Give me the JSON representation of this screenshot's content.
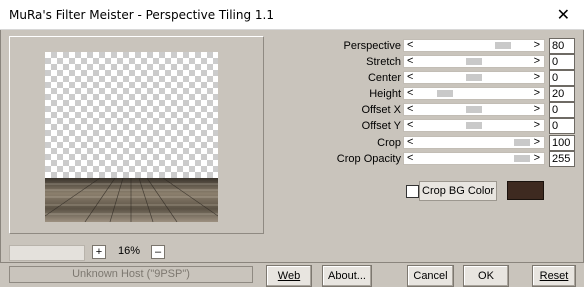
{
  "window": {
    "title": "MuRa's Filter Meister - Perspective Tiling 1.1",
    "close_glyph": "✕"
  },
  "sliders": [
    {
      "label": "Perspective",
      "value": "80",
      "level": 0.8
    },
    {
      "label": "Stretch",
      "value": "0",
      "level": 0.5
    },
    {
      "label": "Center",
      "value": "0",
      "level": 0.5
    },
    {
      "label": "Height",
      "value": "20",
      "level": 0.2
    },
    {
      "label": "Offset X",
      "value": "0",
      "level": 0.5
    },
    {
      "label": "Offset Y",
      "value": "0",
      "level": 0.5
    },
    {
      "label": "Crop",
      "value": "100",
      "level": 1.0
    },
    {
      "label": "Crop Opacity",
      "value": "255",
      "level": 1.0
    }
  ],
  "arrows": {
    "left": "<",
    "right": ">"
  },
  "crop_bg": {
    "label": "Crop BG Color",
    "checked": false,
    "color": "#3e2a20"
  },
  "zoom": {
    "plus": "+",
    "minus": "–",
    "value": "16%"
  },
  "host": {
    "text": "Unknown Host (\"9PSP\")"
  },
  "buttons": {
    "web": "Web",
    "about": "About...",
    "cancel": "Cancel",
    "ok": "OK",
    "reset": "Reset"
  },
  "colors": {
    "dialog_bg": "#c9c4bc",
    "floor": "#6e6455"
  }
}
